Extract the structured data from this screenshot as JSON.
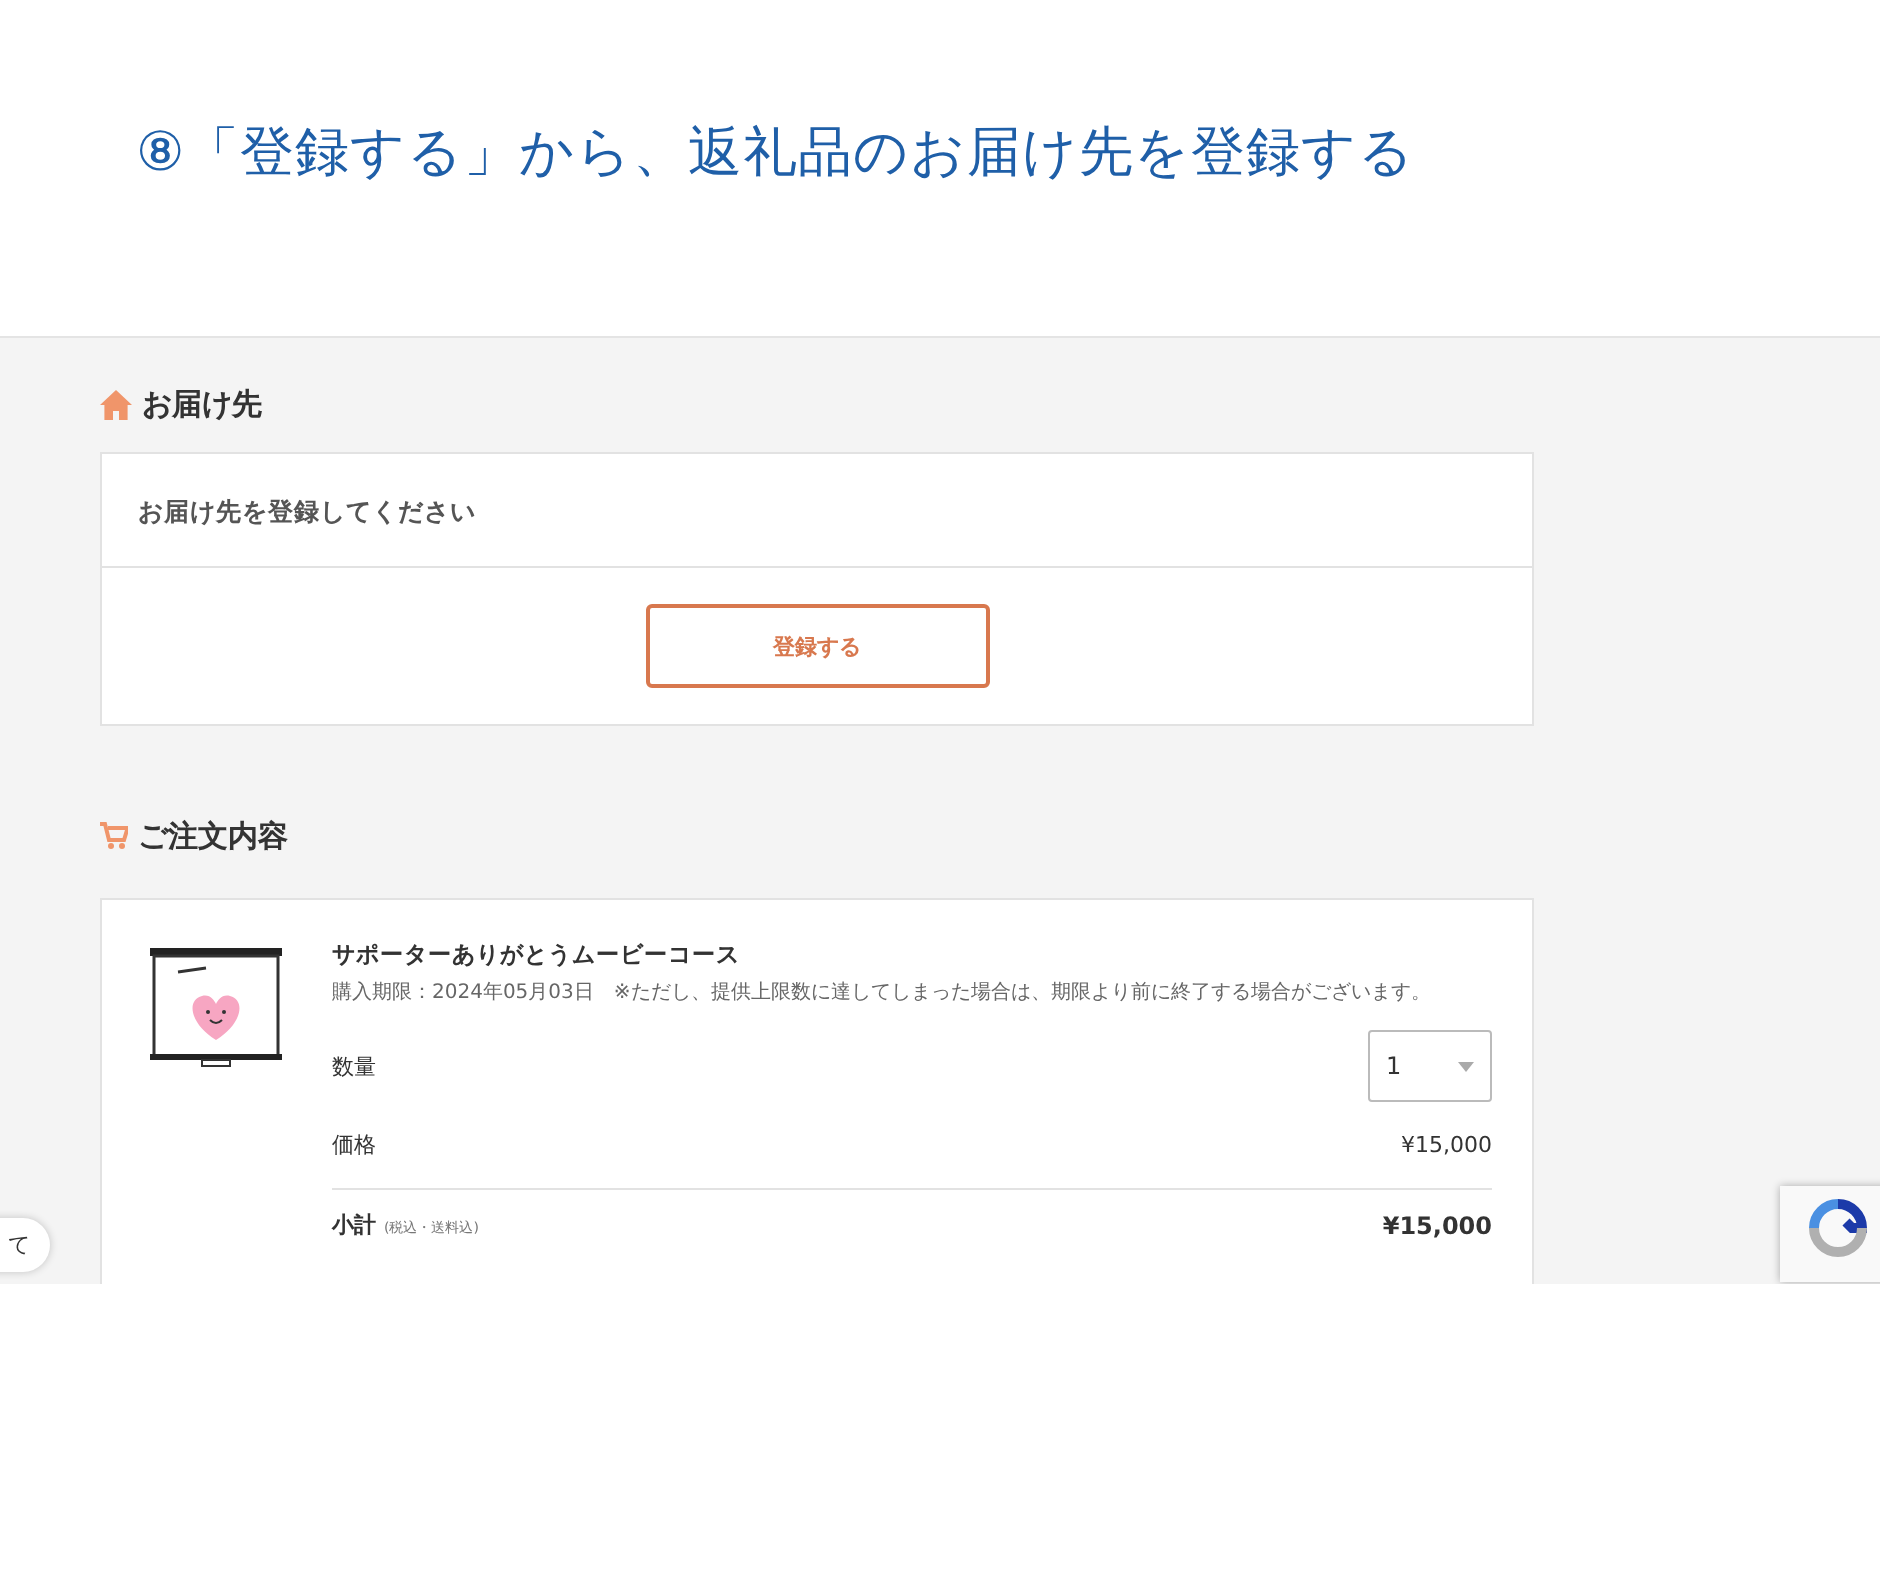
{
  "heading": "⑧「登録する」から、返礼品のお届け先を登録する",
  "delivery": {
    "title": "お届け先",
    "message": "お届け先を登録してください",
    "button": "登録する"
  },
  "order": {
    "title": "ご注文内容",
    "item": {
      "kind": "picture",
      "name": "サポーターありがとうムービーコース",
      "note": "購入期限：2024年05月03日　※ただし、提供上限数に達してしまった場合は、期限より前に終了する場合がございます。",
      "quantity_label": "数量",
      "quantity": "1",
      "price_label": "価格",
      "price": "¥15,000",
      "subtotal_label": "小計",
      "subtotal_note": "(税込・送料込)",
      "subtotal": "¥15,000"
    }
  },
  "side_tab": "て"
}
